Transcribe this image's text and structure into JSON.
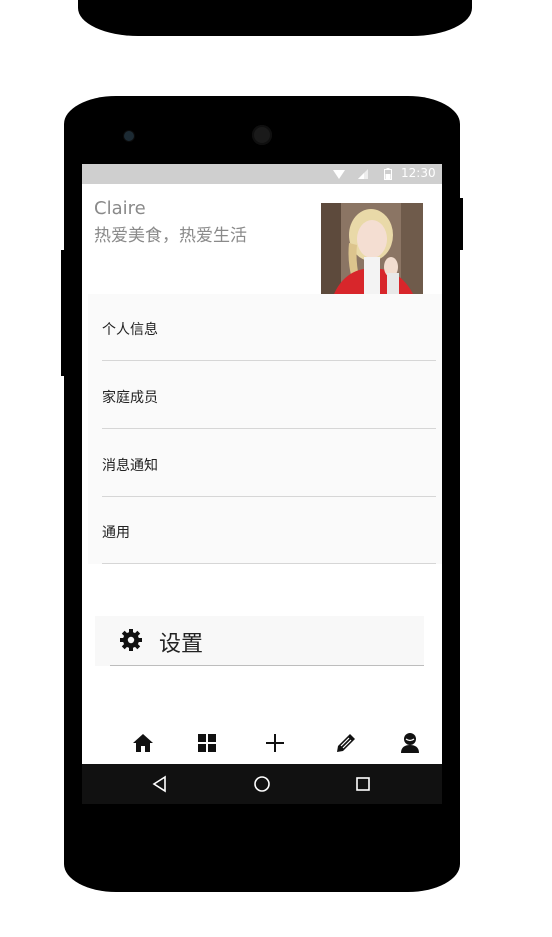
{
  "status_bar": {
    "time": "12:30"
  },
  "profile": {
    "name": "Claire",
    "motto": "热爱美食，热爱生活",
    "avatar_icon": "profile-photo"
  },
  "menu": {
    "items": [
      {
        "label": "个人信息"
      },
      {
        "label": "家庭成员"
      },
      {
        "label": "消息通知"
      },
      {
        "label": "通用"
      }
    ]
  },
  "settings": {
    "label": "设置",
    "icon": "gear-icon"
  },
  "tabbar": {
    "tabs": [
      {
        "icon": "home-icon"
      },
      {
        "icon": "grid-icon"
      },
      {
        "icon": "plus-icon"
      },
      {
        "icon": "edit-icon"
      },
      {
        "icon": "user-icon"
      }
    ]
  },
  "nav_bar": {
    "buttons": [
      "back-icon",
      "home-circle-icon",
      "recents-icon"
    ]
  },
  "colors": {
    "status_bar": "#cfcfcf",
    "profile_text": "#8a8a8a",
    "menu_bg": "#fafafa",
    "nav_bar": "#111111"
  }
}
